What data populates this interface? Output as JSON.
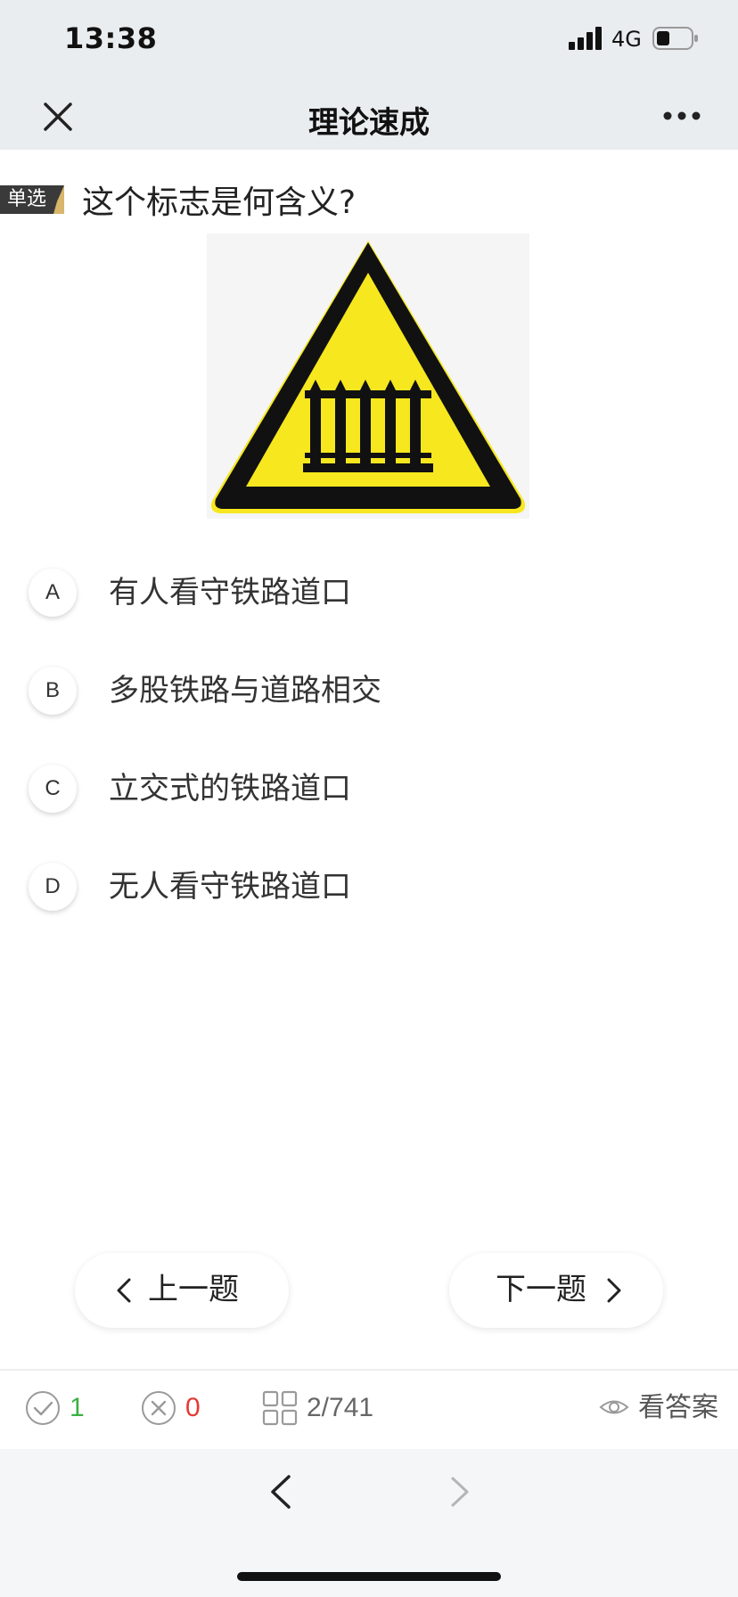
{
  "status_bar": {
    "time": "13:38",
    "network": "4G"
  },
  "nav": {
    "title": "理论速成"
  },
  "question": {
    "type_badge": "单选",
    "text": "这个标志是何含义?",
    "options": [
      {
        "letter": "A",
        "text": "有人看守铁路道口"
      },
      {
        "letter": "B",
        "text": "多股铁路与道路相交"
      },
      {
        "letter": "C",
        "text": "立交式的铁路道口"
      },
      {
        "letter": "D",
        "text": "无人看守铁路道口"
      }
    ]
  },
  "buttons": {
    "prev": "上一题",
    "next": "下一题"
  },
  "footer": {
    "correct": "1",
    "wrong": "0",
    "progress": "2/741",
    "view_answer": "看答案"
  },
  "colors": {
    "correct": "#3cb043",
    "wrong": "#e53935",
    "sign_yellow": "#f6e71f",
    "sign_black": "#111111"
  }
}
